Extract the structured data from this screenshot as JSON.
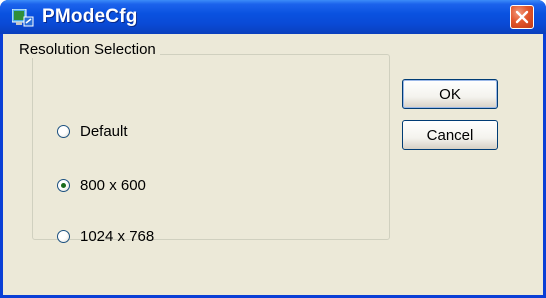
{
  "window": {
    "title": "PModeCfg",
    "app_icon": "pmodecfg-app-icon",
    "close_icon": "close-icon",
    "colors": {
      "titlebar": "#0a52e0",
      "client": "#ece9d8",
      "close": "#e2562c"
    }
  },
  "group": {
    "legend": "Resolution Selection",
    "options": [
      {
        "label": "Default",
        "checked": false
      },
      {
        "label": "800 x 600",
        "checked": true
      },
      {
        "label": "1024 x 768",
        "checked": false
      }
    ]
  },
  "buttons": {
    "ok_label": "OK",
    "cancel_label": "Cancel"
  }
}
